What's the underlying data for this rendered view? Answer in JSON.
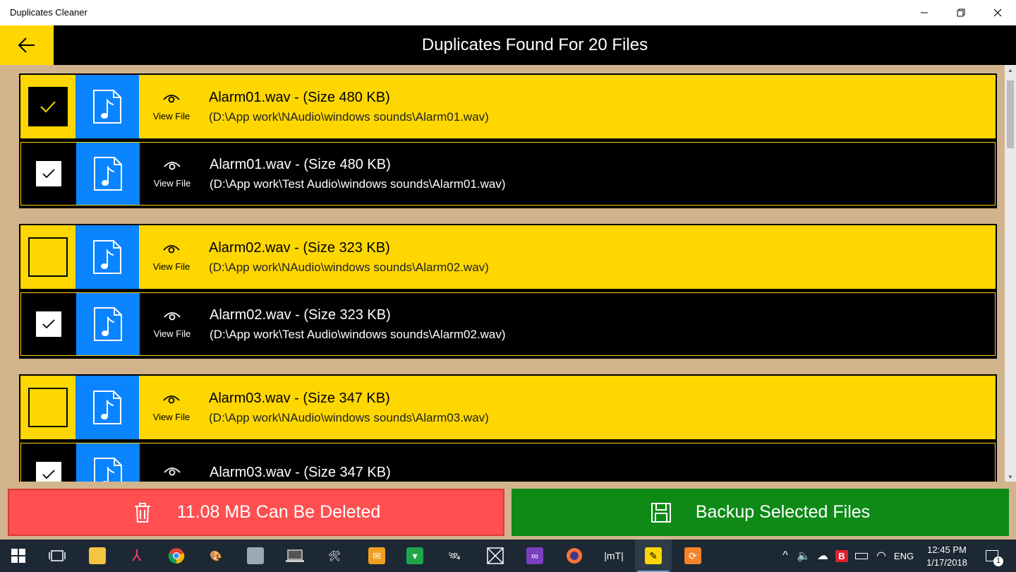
{
  "window": {
    "title": "Duplicates Cleaner"
  },
  "header": {
    "title": "Duplicates Found For 20 Files"
  },
  "colors": {
    "primary_row": "#ffd700",
    "duplicate_row": "#000000",
    "file_icon_bg": "#0a84ff",
    "delete_button": "#ff4f50",
    "backup_button": "#0f8a17",
    "background": "#d2b48c"
  },
  "groups": [
    {
      "primary": {
        "checked": true,
        "name": "Alarm01.wav - (Size 480 KB)",
        "path": "(D:\\App work\\NAudio\\windows sounds\\Alarm01.wav)",
        "view_label": "View File"
      },
      "duplicate": {
        "checked": true,
        "name": "Alarm01.wav - (Size 480 KB)",
        "path": "(D:\\App work\\Test Audio\\windows sounds\\Alarm01.wav)",
        "view_label": "View File"
      }
    },
    {
      "primary": {
        "checked": false,
        "name": "Alarm02.wav - (Size 323 KB)",
        "path": "(D:\\App work\\NAudio\\windows sounds\\Alarm02.wav)",
        "view_label": "View File"
      },
      "duplicate": {
        "checked": true,
        "name": "Alarm02.wav - (Size 323 KB)",
        "path": "(D:\\App work\\Test Audio\\windows sounds\\Alarm02.wav)",
        "view_label": "View File"
      }
    },
    {
      "primary": {
        "checked": false,
        "name": "Alarm03.wav - (Size 347 KB)",
        "path": "(D:\\App work\\NAudio\\windows sounds\\Alarm03.wav)",
        "view_label": "View File"
      },
      "duplicate": {
        "checked": true,
        "name": "Alarm03.wav - (Size 347 KB)",
        "path": "",
        "view_label": ""
      }
    }
  ],
  "footer": {
    "delete_label": "11.08 MB Can Be Deleted",
    "backup_label": "Backup Selected Files"
  },
  "taskbar": {
    "tray_language": "ENG",
    "time": "12:45 PM",
    "date": "1/17/2018",
    "notification_count": "1",
    "apps": [
      "start-icon",
      "task-view-icon",
      "file-explorer-icon",
      "app-red-icon",
      "chrome-icon",
      "paint-icon",
      "app-icon",
      "laptop-icon",
      "tools-icon",
      "mail-icon",
      "store-app-icon",
      "satellite-icon",
      "window-x-icon",
      "visual-studio-icon",
      "firefox-icon",
      "mt-icon",
      "duplicates-cleaner-icon",
      "pdf-icon"
    ]
  }
}
